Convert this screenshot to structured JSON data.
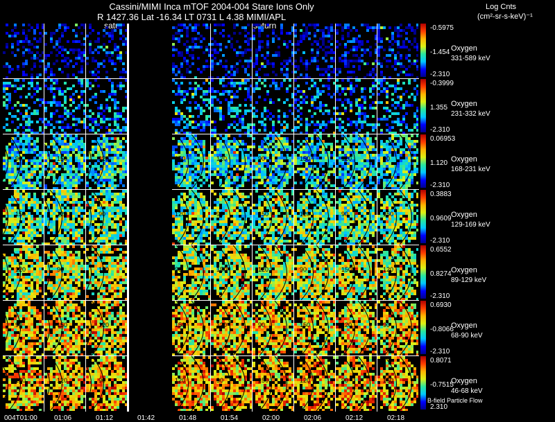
{
  "header": {
    "title": "Cassini/MIMI Inca mTOF  2004-004   Stare   Ions Only",
    "subtitle": "R      1427.36 Lat -16.34 LT 0731 L        4.38  MIMI/APL",
    "saturn_tags": [
      "satur",
      "saturn"
    ],
    "scale_title": "Log Cnts",
    "scale_units": "(cm²-sr-s-keV)⁻¹"
  },
  "rows": [
    {
      "species": "Oxygen",
      "energy": "331-589 keV",
      "max": "-0.5975",
      "mid": "-1.454",
      "min": "-2.310"
    },
    {
      "species": "Oxygen",
      "energy": "231-332 keV",
      "max": "-0.3999",
      "mid": "1.355",
      "min": "-2.310"
    },
    {
      "species": "Oxygen",
      "energy": "168-231 keV",
      "max": "0.06953",
      "mid": "1.120",
      "min": "-2.310"
    },
    {
      "species": "Oxygen",
      "energy": "129-169 keV",
      "max": "0.3883",
      "mid": "0.9609",
      "min": "-2.310"
    },
    {
      "species": "Oxygen",
      "energy": "89-129 keV",
      "max": "0.6552",
      "mid": "0.8274",
      "min": "-2.310"
    },
    {
      "species": "Oxygen",
      "energy": "68-90 keV",
      "max": "0.6930",
      "mid": "-0.8066",
      "min": "-2.310"
    },
    {
      "species": "Oxygen",
      "energy": "46-68 keV",
      "max": "0.8071",
      "mid": "-0.7515",
      "min": "2.310"
    }
  ],
  "times": [
    "004T01:00",
    "01:06",
    "01:12",
    "01:42",
    "01:48",
    "01:54",
    "02:00",
    "02:06",
    "02:12",
    "02:18"
  ],
  "bfield_label": "B-field Particle Flow",
  "contour_labels": [
    "150",
    "120",
    "90"
  ],
  "colors": {
    "background": "#000000",
    "text": "#ffffff"
  }
}
